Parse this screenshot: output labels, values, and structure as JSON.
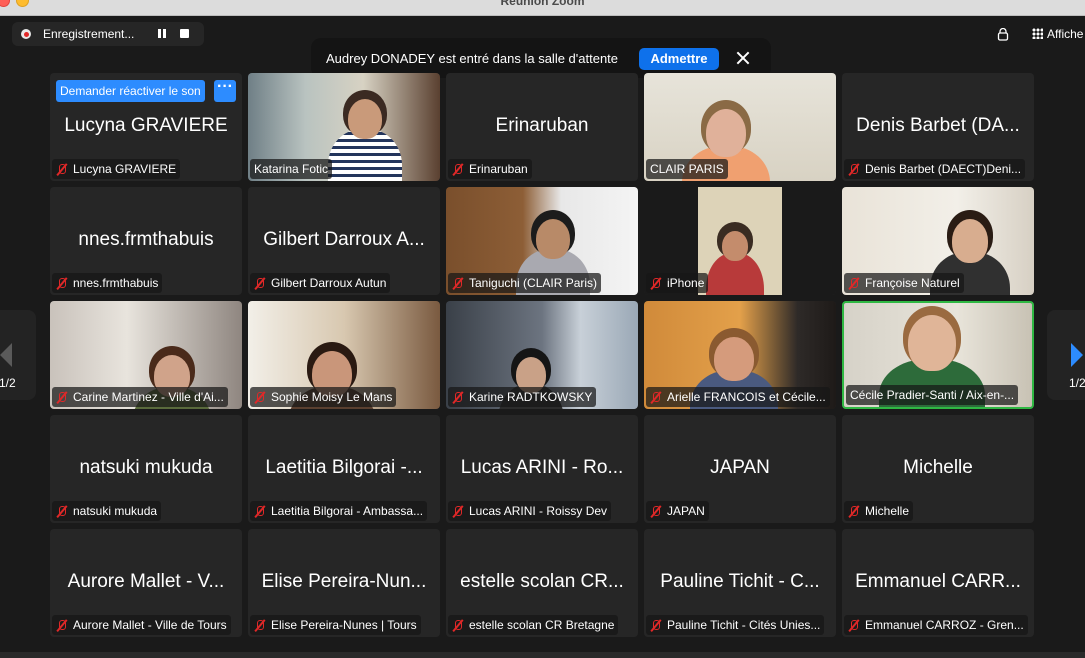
{
  "window": {
    "title": "Réunion Zoom"
  },
  "recording": {
    "label": "Enregistrement..."
  },
  "view": {
    "label": "Affiche"
  },
  "notification": {
    "text": "Audrey DONADEY est entré dans la salle d'attente",
    "admit_label": "Admettre"
  },
  "pagination": {
    "left": "1/2",
    "right": "1/2"
  },
  "first_tile": {
    "unmute_label": "Demander réactiver le son"
  },
  "tiles": [
    {
      "center": "Lucyna GRAVIERE",
      "name": "Lucyna GRAVIERE",
      "muted": true
    },
    {
      "center": "",
      "name": "Katarina Fotic",
      "muted": false
    },
    {
      "center": "Erinaruban",
      "name": "Erinaruban",
      "muted": true
    },
    {
      "center": "",
      "name": "CLAIR PARIS",
      "muted": false
    },
    {
      "center": "Denis Barbet (DA...",
      "name": "Denis Barbet (DAECT)Deni...",
      "muted": true
    },
    {
      "center": "nnes.frmthabuis",
      "name": "nnes.frmthabuis",
      "muted": true
    },
    {
      "center": "Gilbert Darroux A...",
      "name": "Gilbert Darroux Autun",
      "muted": true
    },
    {
      "center": "",
      "name": "Taniguchi  (CLAIR Paris)",
      "muted": true
    },
    {
      "center": "",
      "name": "iPhone",
      "muted": true
    },
    {
      "center": "",
      "name": "Françoise Naturel",
      "muted": true
    },
    {
      "center": "",
      "name": "Carine Martinez - Ville d'Ai...",
      "muted": true
    },
    {
      "center": "",
      "name": "Sophie Moisy Le Mans",
      "muted": true
    },
    {
      "center": "",
      "name": "Karine RADTKOWSKY",
      "muted": true
    },
    {
      "center": "",
      "name": "Arielle FRANCOIS et Cécile...",
      "muted": true
    },
    {
      "center": "",
      "name": "Cécile Pradier-Santi / Aix-en-...",
      "muted": false
    },
    {
      "center": "natsuki mukuda",
      "name": "natsuki mukuda",
      "muted": true
    },
    {
      "center": "Laetitia Bilgorai -...",
      "name": "Laetitia Bilgorai - Ambassa...",
      "muted": true
    },
    {
      "center": "Lucas ARINI - Ro...",
      "name": "Lucas ARINI - Roissy Dev",
      "muted": true
    },
    {
      "center": "JAPAN",
      "name": "JAPAN",
      "muted": true
    },
    {
      "center": "Michelle",
      "name": "Michelle",
      "muted": true
    },
    {
      "center": "Aurore Mallet - V...",
      "name": "Aurore Mallet - Ville de Tours",
      "muted": true
    },
    {
      "center": "Elise Pereira-Nun...",
      "name": "Elise Pereira-Nunes | Tours",
      "muted": true
    },
    {
      "center": "estelle scolan CR...",
      "name": "estelle scolan CR Bretagne",
      "muted": true
    },
    {
      "center": "Pauline Tichit - C...",
      "name": "Pauline Tichit - Cités Unies...",
      "muted": true
    },
    {
      "center": "Emmanuel CARR...",
      "name": "Emmanuel CARROZ - Gren...",
      "muted": true
    }
  ],
  "colors": {
    "admit": "#0e71eb",
    "accent": "#2d8cff",
    "active_speaker": "#2fb843",
    "muted": "#e02828"
  }
}
